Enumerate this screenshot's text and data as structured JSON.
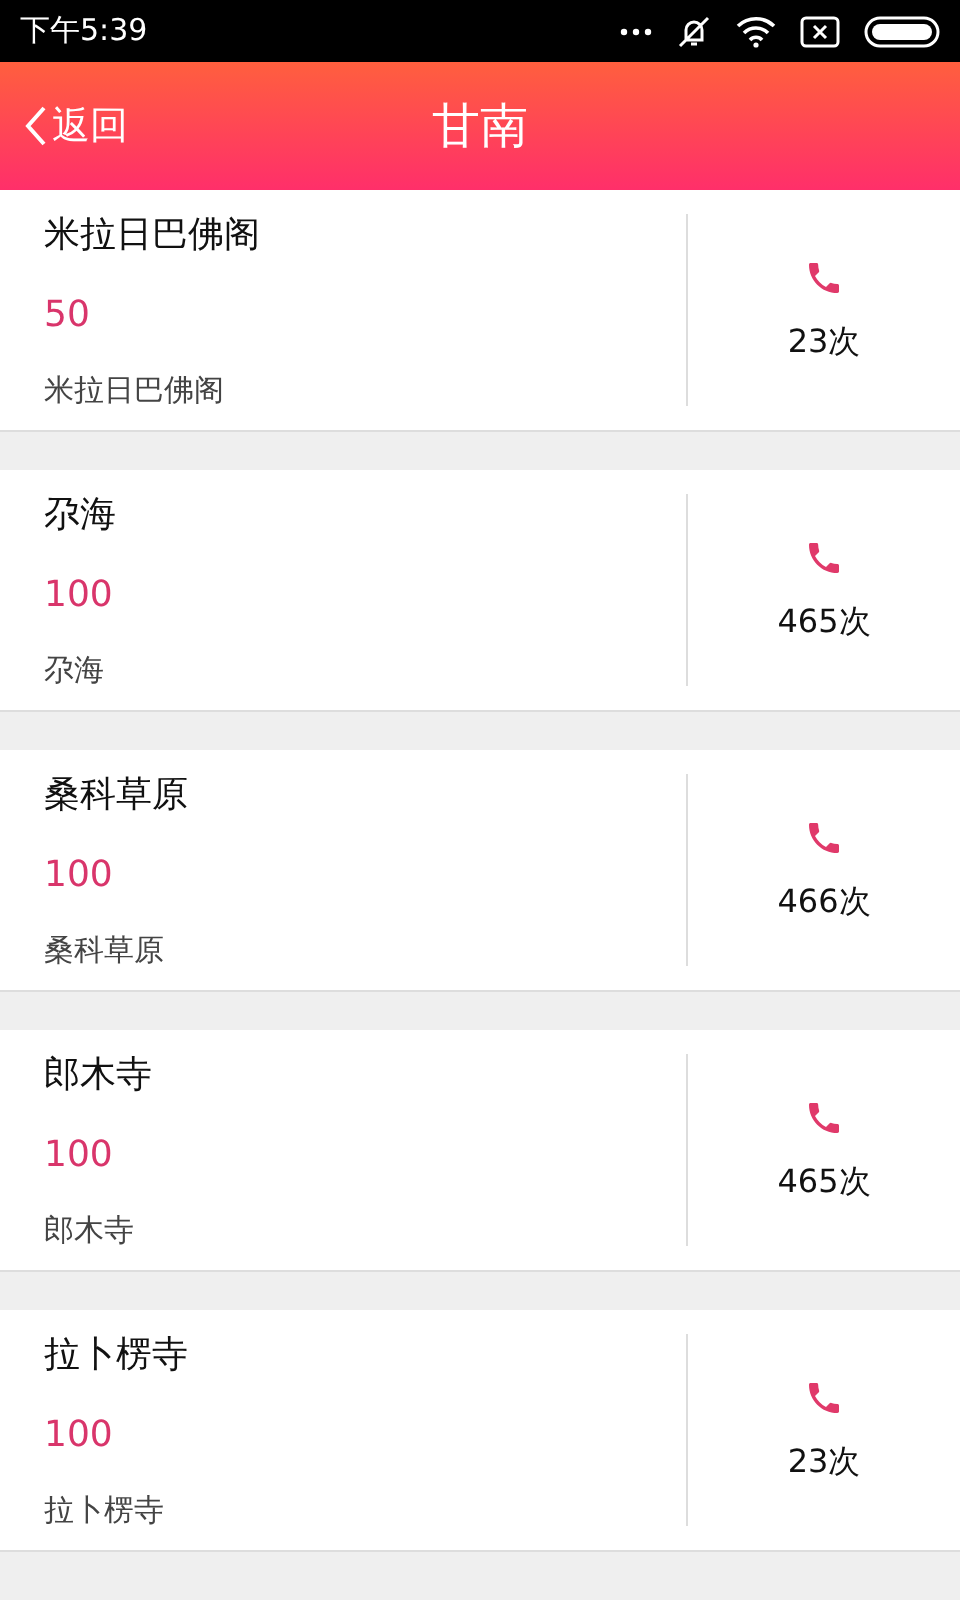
{
  "status_bar": {
    "time": "下午5:39"
  },
  "header": {
    "back": "返回",
    "title": "甘南"
  },
  "items": [
    {
      "name": "米拉日巴佛阁",
      "price": "50",
      "subtitle": "米拉日巴佛阁",
      "calls": "23次"
    },
    {
      "name": "尕海",
      "price": "100",
      "subtitle": "尕海",
      "calls": "465次"
    },
    {
      "name": "桑科草原",
      "price": "100",
      "subtitle": "桑科草原",
      "calls": "466次"
    },
    {
      "name": "郎木寺",
      "price": "100",
      "subtitle": "郎木寺",
      "calls": "465次"
    },
    {
      "name": "拉卜楞寺",
      "price": "100",
      "subtitle": "拉卜楞寺",
      "calls": "23次"
    }
  ]
}
